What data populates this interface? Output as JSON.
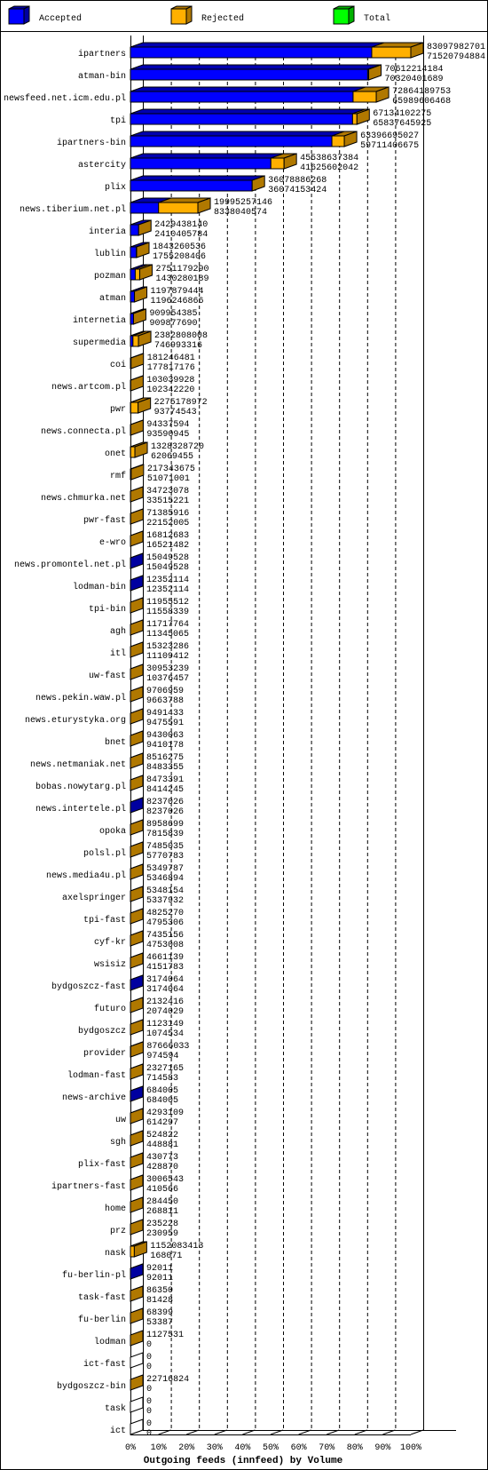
{
  "legend": [
    {
      "label": "Accepted",
      "color": "#0000ff",
      "shade": "#0000a0"
    },
    {
      "label": "Rejected",
      "color": "#ffb000",
      "shade": "#b07800"
    },
    {
      "label": "Total",
      "color": "#00ff00",
      "shade": "#00b000"
    }
  ],
  "chart_data": {
    "type": "bar",
    "orientation": "horizontal",
    "style": "3d-stacked",
    "xlabel": "Outgoing feeds (innfeed) by Volume",
    "x_ticks": [
      "0%",
      "10%",
      "20%",
      "30%",
      "40%",
      "50%",
      "60%",
      "70%",
      "80%",
      "90%",
      "100%"
    ],
    "xlim": [
      0,
      100
    ],
    "grid": "vertical-dashed",
    "legend_position": "top",
    "value_labels_order": [
      "offered total",
      "accepted"
    ],
    "rows": [
      {
        "name": "ipartners",
        "offered": "83097982701",
        "accepted": "71520794884"
      },
      {
        "name": "atman-bin",
        "offered": "70612214184",
        "accepted": "70320401689"
      },
      {
        "name": "newsfeed.net.icm.edu.pl",
        "offered": "72864189753",
        "accepted": "65989606468"
      },
      {
        "name": "tpi",
        "offered": "67134102275",
        "accepted": "65837645925"
      },
      {
        "name": "ipartners-bin",
        "offered": "63396695027",
        "accepted": "59711406675"
      },
      {
        "name": "astercity",
        "offered": "45538637384",
        "accepted": "41625602042"
      },
      {
        "name": "plix",
        "offered": "36078886268",
        "accepted": "36074153424"
      },
      {
        "name": "news.tiberium.net.pl",
        "offered": "19995257146",
        "accepted": "8338040574"
      },
      {
        "name": "interia",
        "offered": "2429438140",
        "accepted": "2410405784"
      },
      {
        "name": "lublin",
        "offered": "1843260536",
        "accepted": "1755208406"
      },
      {
        "name": "pozman",
        "offered": "2751179290",
        "accepted": "1430280189"
      },
      {
        "name": "atman",
        "offered": "1197879444",
        "accepted": "1196246866"
      },
      {
        "name": "internetia",
        "offered": "909954385",
        "accepted": "909877690"
      },
      {
        "name": "supermedia",
        "offered": "2382808008",
        "accepted": "746993316"
      },
      {
        "name": "coi",
        "offered": "181246481",
        "accepted": "177817176"
      },
      {
        "name": "news.artcom.pl",
        "offered": "103039928",
        "accepted": "102342220"
      },
      {
        "name": "pwr",
        "offered": "2275178972",
        "accepted": "93774543"
      },
      {
        "name": "news.connecta.pl",
        "offered": "94337594",
        "accepted": "93590945"
      },
      {
        "name": "onet",
        "offered": "1328328720",
        "accepted": "62069455"
      },
      {
        "name": "rmf",
        "offered": "217343675",
        "accepted": "51071001"
      },
      {
        "name": "news.chmurka.net",
        "offered": "34723078",
        "accepted": "33515221"
      },
      {
        "name": "pwr-fast",
        "offered": "71385916",
        "accepted": "22152005"
      },
      {
        "name": "e-wro",
        "offered": "16812683",
        "accepted": "16521482"
      },
      {
        "name": "news.promontel.net.pl",
        "offered": "15049528",
        "accepted": "15049528"
      },
      {
        "name": "lodman-bin",
        "offered": "12352114",
        "accepted": "12352114"
      },
      {
        "name": "tpi-bin",
        "offered": "11955512",
        "accepted": "11558339"
      },
      {
        "name": "agh",
        "offered": "11717764",
        "accepted": "11345065"
      },
      {
        "name": "itl",
        "offered": "15323286",
        "accepted": "11109412"
      },
      {
        "name": "uw-fast",
        "offered": "30953239",
        "accepted": "10376457"
      },
      {
        "name": "news.pekin.waw.pl",
        "offered": "9706959",
        "accepted": "9663788"
      },
      {
        "name": "news.eturystyka.org",
        "offered": "9491433",
        "accepted": "9475591"
      },
      {
        "name": "bnet",
        "offered": "9430063",
        "accepted": "9410178"
      },
      {
        "name": "news.netmaniak.net",
        "offered": "8516275",
        "accepted": "8483355"
      },
      {
        "name": "bobas.nowytarg.pl",
        "offered": "8473391",
        "accepted": "8414245"
      },
      {
        "name": "news.intertele.pl",
        "offered": "8237026",
        "accepted": "8237026"
      },
      {
        "name": "opoka",
        "offered": "8958699",
        "accepted": "7815839"
      },
      {
        "name": "polsl.pl",
        "offered": "7485035",
        "accepted": "5770783"
      },
      {
        "name": "news.media4u.pl",
        "offered": "5349787",
        "accepted": "5346894"
      },
      {
        "name": "axelspringer",
        "offered": "5348154",
        "accepted": "5337932"
      },
      {
        "name": "tpi-fast",
        "offered": "4825270",
        "accepted": "4795306"
      },
      {
        "name": "cyf-kr",
        "offered": "7435156",
        "accepted": "4753008"
      },
      {
        "name": "wsisiz",
        "offered": "4661139",
        "accepted": "4151783"
      },
      {
        "name": "bydgoszcz-fast",
        "offered": "3174064",
        "accepted": "3174064"
      },
      {
        "name": "futuro",
        "offered": "2132416",
        "accepted": "2074029"
      },
      {
        "name": "bydgoszcz",
        "offered": "1123149",
        "accepted": "1074534"
      },
      {
        "name": "provider",
        "offered": "87666033",
        "accepted": "974594"
      },
      {
        "name": "lodman-fast",
        "offered": "2327165",
        "accepted": "714583"
      },
      {
        "name": "news-archive",
        "offered": "684005",
        "accepted": "684005"
      },
      {
        "name": "uw",
        "offered": "4293109",
        "accepted": "614297"
      },
      {
        "name": "sgh",
        "offered": "524822",
        "accepted": "448881"
      },
      {
        "name": "plix-fast",
        "offered": "430773",
        "accepted": "428870"
      },
      {
        "name": "ipartners-fast",
        "offered": "3006543",
        "accepted": "410566"
      },
      {
        "name": "home",
        "offered": "284450",
        "accepted": "268811"
      },
      {
        "name": "prz",
        "offered": "235228",
        "accepted": "230959"
      },
      {
        "name": "nask",
        "offered": "1152083413",
        "accepted": "168071"
      },
      {
        "name": "fu-berlin-pl",
        "offered": "92011",
        "accepted": "92011"
      },
      {
        "name": "task-fast",
        "offered": "86350",
        "accepted": "81428"
      },
      {
        "name": "fu-berlin",
        "offered": "68399",
        "accepted": "53387"
      },
      {
        "name": "lodman",
        "offered": "1127531",
        "accepted": "0"
      },
      {
        "name": "ict-fast",
        "offered": "0",
        "accepted": "0"
      },
      {
        "name": "bydgoszcz-bin",
        "offered": "22716824",
        "accepted": "0"
      },
      {
        "name": "task",
        "offered": "0",
        "accepted": "0"
      },
      {
        "name": "ict",
        "offered": "0",
        "accepted": "0"
      }
    ]
  }
}
